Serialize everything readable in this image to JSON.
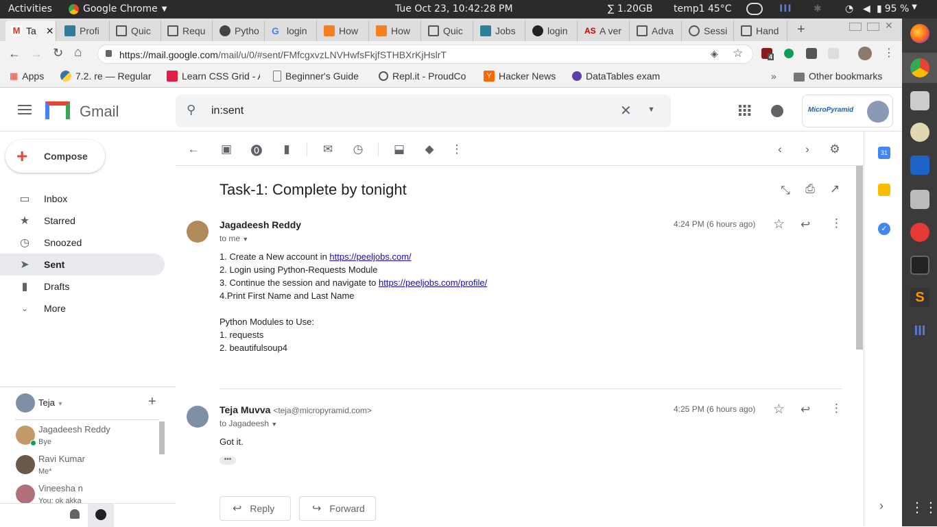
{
  "system": {
    "activities": "Activities",
    "app": "Google Chrome",
    "clock": "Tue Oct 23, 10:42:28 PM",
    "memory": "∑ 1.20GB",
    "temp": "temp1 45°C",
    "battery": "95 %"
  },
  "browser": {
    "tabs": [
      {
        "label": "Ta",
        "icon": "gmail-icon",
        "color": "#d93025"
      },
      {
        "label": "Profi",
        "icon": "peeljobs-icon",
        "color": "#2e7d9a"
      },
      {
        "label": "Quic",
        "icon": "doc-icon",
        "color": "#555"
      },
      {
        "label": "Requ",
        "icon": "doc-icon",
        "color": "#555"
      },
      {
        "label": "Pytho",
        "icon": "python-icon",
        "color": "#333"
      },
      {
        "label": "login",
        "icon": "google-icon",
        "color": "#4285f4"
      },
      {
        "label": "How",
        "icon": "stackoverflow-icon",
        "color": "#f48024"
      },
      {
        "label": "How",
        "icon": "stackoverflow-icon",
        "color": "#f48024"
      },
      {
        "label": "Quic",
        "icon": "doc-icon",
        "color": "#555"
      },
      {
        "label": "Jobs",
        "icon": "peeljobs-icon",
        "color": "#2e7d9a"
      },
      {
        "label": "login",
        "icon": "github-icon",
        "color": "#222"
      },
      {
        "label": "A ver",
        "icon": "as-icon",
        "color": "#c00"
      },
      {
        "label": "Adva",
        "icon": "doc-icon",
        "color": "#555"
      },
      {
        "label": "Sessi",
        "icon": "globe-icon",
        "color": "#555"
      },
      {
        "label": "Hand",
        "icon": "book-icon",
        "color": "#555"
      }
    ],
    "url": "https://mail.google.com/mail/u/0/#sent/FMfcgxvzLNVHwfsFkjfSTHBXrKjHslrT",
    "url_host": "https://mail.google.com",
    "url_path": "/mail/u/0/#sent/FMfcgxvzLNVHwfsFkjfSTHBXrKjHslrT",
    "bookmarks": [
      {
        "label": "Apps"
      },
      {
        "label": "7.2. re — Regular"
      },
      {
        "label": "Learn CSS Grid - A"
      },
      {
        "label": "Beginner's Guide"
      },
      {
        "label": "Repl.it - ProudCo"
      },
      {
        "label": "Hacker News"
      },
      {
        "label": "DataTables exam"
      }
    ],
    "other_bookmarks": "Other bookmarks",
    "extension_badge": "4"
  },
  "gmail": {
    "logo_text": "Gmail",
    "search_value": "in:sent",
    "account_brand": "MicroPyramid",
    "compose": "Compose",
    "nav": [
      {
        "label": "Inbox",
        "icon": "inbox-icon"
      },
      {
        "label": "Starred",
        "icon": "star-icon"
      },
      {
        "label": "Snoozed",
        "icon": "clock-icon"
      },
      {
        "label": "Sent",
        "icon": "send-icon"
      },
      {
        "label": "Drafts",
        "icon": "draft-icon"
      },
      {
        "label": "More",
        "icon": "chevron-down-icon"
      }
    ],
    "hangouts_user": "Teja",
    "contacts": [
      {
        "name": "Jagadeesh Reddy",
        "status": "Bye",
        "online": true
      },
      {
        "name": "Ravi Kumar",
        "status": "Me*",
        "online": false
      },
      {
        "name": "Vineesha n",
        "status": "You: ok akka",
        "online": false
      }
    ],
    "subject": "Task-1: Complete by tonight",
    "messages": [
      {
        "sender": "Jagadeesh Reddy",
        "email": "",
        "to": "to me",
        "time": "4:24 PM (6 hours ago)",
        "lines": {
          "l1_text": "1. Create a New account in ",
          "l1_link": "https://peeljobs.com/",
          "l2": "2. Login using Python-Requests Module",
          "l3_text": "3. Continue the session and navigate to ",
          "l3_link": "https://peeljobs.com/profile/",
          "l4": "4.Print First Name and Last Name",
          "l5": "Python Modules to Use:",
          "l6": "1. requests",
          "l7": "2. beautifulsoup4"
        }
      },
      {
        "sender": "Teja Muvva",
        "email": "<teja@micropyramid.com>",
        "to": "to Jagadeesh",
        "time": "4:25 PM (6 hours ago)",
        "body": "Got it."
      }
    ],
    "reply": "Reply",
    "forward": "Forward",
    "colors": {
      "accent": "#1a73e8",
      "active_nav": "#e8eaed",
      "link": "#1a0dab"
    }
  }
}
